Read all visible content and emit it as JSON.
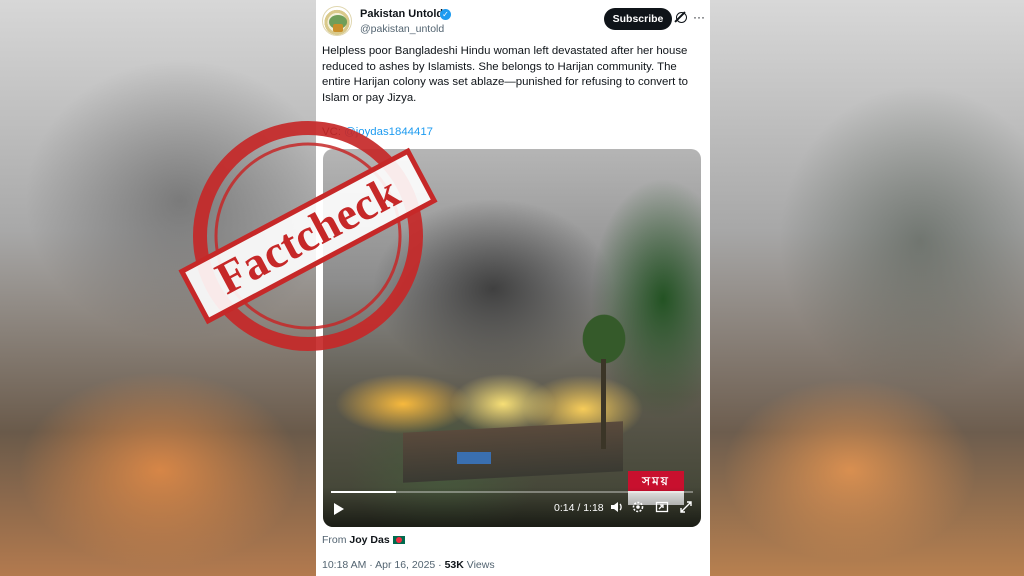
{
  "post": {
    "author_name": "Pakistan Untold",
    "author_handle": "@pakistan_untold",
    "subscribe_label": "Subscribe",
    "more_label": "···",
    "text": "Helpless poor Bangladeshi Hindu woman left devastated after her house reduced to ashes by Islamists. She belongs to Harijan community. The entire Harijan colony was set ablaze—punished for refusing to convert to Islam or pay Jizya.",
    "vc_prefix": "VC: ",
    "vc_mention": "@joydas1844417",
    "from_prefix": "From ",
    "from_name": "Joy Das",
    "timestamp": "10:18 AM · Apr 16, 2025 · ",
    "views_count": "53K",
    "views_label": " Views"
  },
  "video": {
    "current_time": "0:14",
    "duration": "1:18",
    "time_sep": " / ",
    "progress_fraction": 0.18,
    "channel_logo_text": "সময়"
  },
  "overlay": {
    "stamp_text": "Factcheck",
    "stamp_color": "#c62828"
  },
  "icons": {
    "verified": "verified-badge-icon",
    "grok": "grok-icon",
    "more": "more-icon",
    "play": "play-icon",
    "volume": "volume-icon",
    "settings": "settings-icon",
    "pip": "picture-in-picture-icon",
    "fullscreen": "fullscreen-icon",
    "flag": "bangladesh-flag-icon"
  }
}
